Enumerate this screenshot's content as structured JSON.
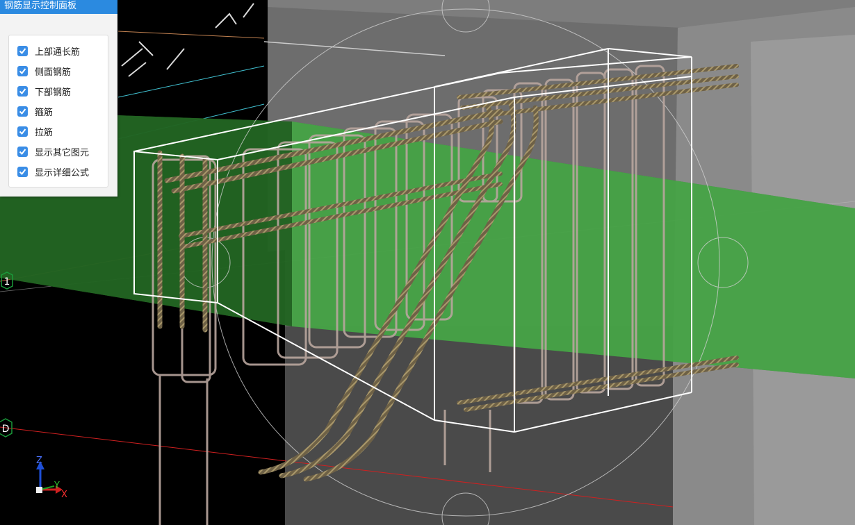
{
  "panel": {
    "title": "钢筋显示控制面板",
    "options": [
      {
        "label": "上部通长筋",
        "checked": true
      },
      {
        "label": "侧面钢筋",
        "checked": true
      },
      {
        "label": "下部钢筋",
        "checked": true
      },
      {
        "label": "箍筋",
        "checked": true
      },
      {
        "label": "拉筋",
        "checked": true
      },
      {
        "label": "显示其它图元",
        "checked": true
      },
      {
        "label": "显示详细公式",
        "checked": true
      }
    ]
  },
  "viewport": {
    "axis_markers": {
      "one": "1",
      "d": "D"
    },
    "triad": {
      "z": "Z",
      "y": "Y",
      "x": "X"
    }
  },
  "colors": {
    "accent": "#2b8ae0",
    "checkbox": "#3a8de6",
    "background": "#000000",
    "concrete": "#6f6f6f",
    "beam_green": "#3f9f3f",
    "rebar": "#8a7a5a",
    "stirrup": "#b7a49c"
  }
}
